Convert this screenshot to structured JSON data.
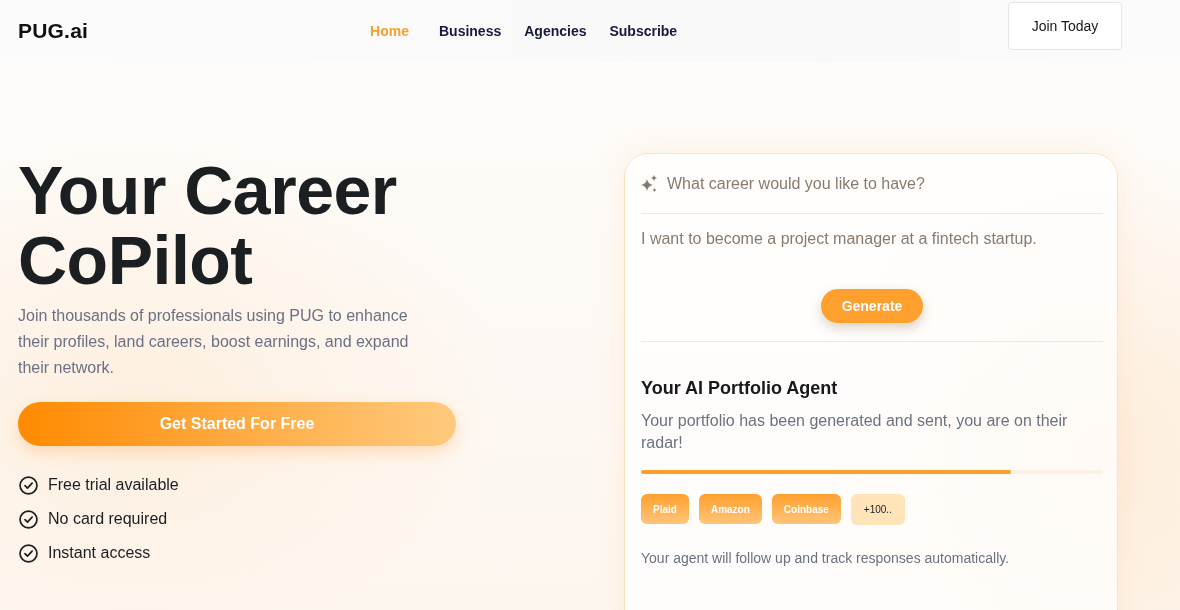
{
  "nav": {
    "logo": "PUG.ai",
    "links": [
      {
        "label": "Home",
        "selected": true
      },
      {
        "label": "Business",
        "selected": false
      },
      {
        "label": "Agencies",
        "selected": false
      },
      {
        "label": "Subscribe",
        "selected": false
      }
    ],
    "cta": "Join Today"
  },
  "hero": {
    "title": "Your Career CoPilot",
    "description": "Join thousands of professionals using PUG to enhance their profiles, land careers, boost earnings, and expand their network.",
    "cta": "Get Started For Free",
    "features": [
      "Free trial available",
      "No card required",
      "Instant access"
    ]
  },
  "card": {
    "prompt_label": "What career would you like to have?",
    "prompt_field": {
      "placeholder": "I want to become a project manager at a fintech startup."
    },
    "generate": "Generate",
    "agent": {
      "title": "Your AI Portfolio Agent",
      "message": "Your portfolio has been generated and sent, you are on their radar!",
      "progress": {
        "level": 0.8
      },
      "tags": [
        {
          "label": "Plaid",
          "kind": "company"
        },
        {
          "label": "Amazon",
          "kind": "company"
        },
        {
          "label": "Coinbase",
          "kind": "company"
        },
        {
          "label": "+100..",
          "kind": "more"
        }
      ],
      "note": "Your agent will follow up and track responses automatically."
    }
  }
}
